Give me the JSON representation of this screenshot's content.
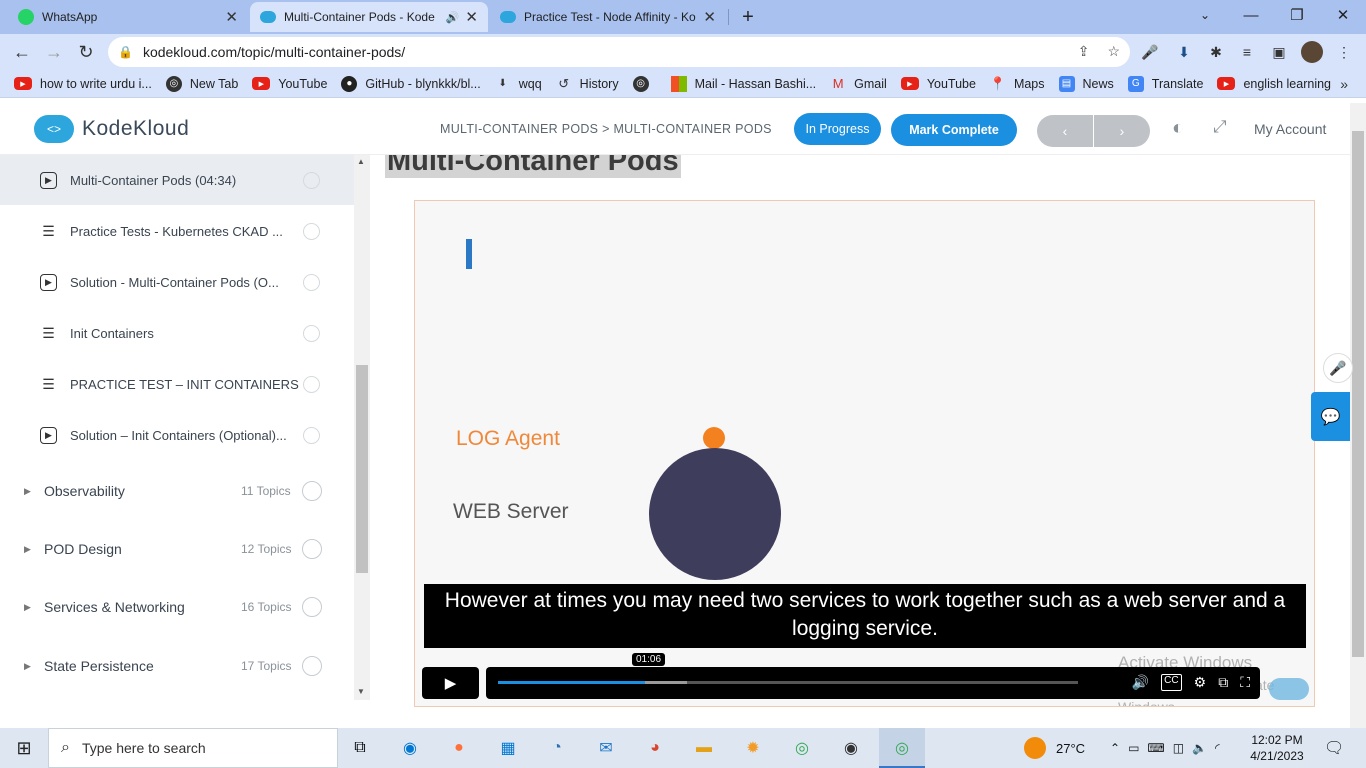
{
  "browser": {
    "tabs": [
      {
        "title": "WhatsApp",
        "icon": "whatsapp-icon",
        "color": "#25d366"
      },
      {
        "title": "Multi-Container Pods - Kode",
        "icon": "kodekloud-icon",
        "color": "#2ca6dc"
      },
      {
        "title": "Practice Test - Node Affinity - Ko",
        "icon": "kodekloud-icon",
        "color": "#2ca6dc"
      }
    ],
    "url": "kodekloud.com/topic/multi-container-pods/",
    "bookmarks": [
      {
        "label": "how to write urdu i...",
        "icon": "youtube-icon"
      },
      {
        "label": "New Tab",
        "icon": "globe-icon"
      },
      {
        "label": "YouTube",
        "icon": "youtube-icon"
      },
      {
        "label": "GitHub - blynkkk/bl...",
        "icon": "github-icon"
      },
      {
        "label": "wqq",
        "icon": "download-icon"
      },
      {
        "label": "History",
        "icon": "history-icon"
      },
      {
        "label": "",
        "icon": "globe-icon"
      },
      {
        "label": "Mail - Hassan Bashi...",
        "icon": "microsoft-icon"
      },
      {
        "label": "Gmail",
        "icon": "gmail-icon"
      },
      {
        "label": "YouTube",
        "icon": "youtube-icon"
      },
      {
        "label": "Maps",
        "icon": "maps-icon"
      },
      {
        "label": "News",
        "icon": "news-icon"
      },
      {
        "label": "Translate",
        "icon": "translate-icon"
      },
      {
        "label": "english learning",
        "icon": "youtube-icon"
      }
    ]
  },
  "header": {
    "logo_text": "KodeKloud",
    "breadcrumb": "MULTI-CONTAINER PODS > MULTI-CONTAINER PODS",
    "status_label": "In Progress",
    "complete_label": "Mark Complete",
    "prev_label": "‹",
    "next_label": "›",
    "account_label": "My Account"
  },
  "sidebar": {
    "lessons": [
      {
        "title": "Multi-Container Pods (04:34)",
        "type": "video",
        "current": true
      },
      {
        "title": "Practice Tests - Kubernetes CKAD ...",
        "type": "doc",
        "current": false
      },
      {
        "title": "Solution - Multi-Container Pods (O...",
        "type": "video",
        "current": false
      },
      {
        "title": "Init Containers",
        "type": "doc",
        "current": false
      },
      {
        "title": "PRACTICE TEST – INIT CONTAINERS",
        "type": "doc",
        "current": false
      },
      {
        "title": "Solution – Init Containers (Optional)...",
        "type": "video",
        "current": false
      }
    ],
    "sections": [
      {
        "title": "Observability",
        "count": "11 Topics"
      },
      {
        "title": "POD Design",
        "count": "12 Topics"
      },
      {
        "title": "Services & Networking",
        "count": "16 Topics"
      },
      {
        "title": "State Persistence",
        "count": "17 Topics"
      }
    ]
  },
  "main": {
    "title": "Multi-Container Pods",
    "video": {
      "slide_label_1": "LOG Agent",
      "slide_label_2": "WEB Server",
      "caption": "However at times you may need two services to work together such as a web server and a logging service.",
      "current_time": "01:06",
      "progress_fraction": 0.254,
      "buffered_fraction": 0.326,
      "watermark_line1": "Activate Windows",
      "watermark_line2": "Go to Settings to activate Windows."
    }
  },
  "taskbar": {
    "search_placeholder": "Type here to search",
    "temperature": "27°C",
    "time": "12:02 PM",
    "date": "4/21/2023"
  }
}
